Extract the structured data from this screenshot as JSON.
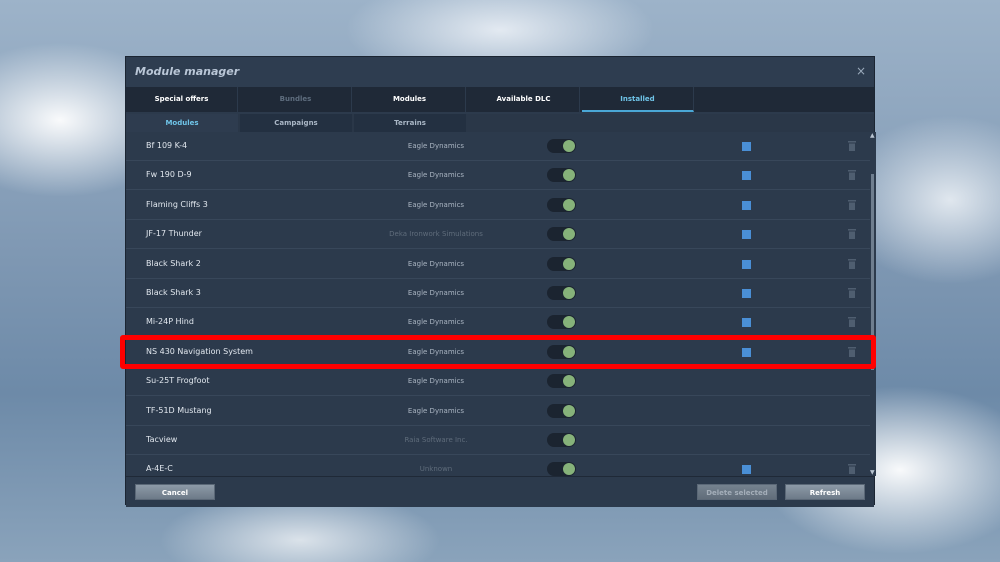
{
  "window": {
    "title": "Module manager",
    "close_glyph": "×"
  },
  "top_tabs": [
    {
      "label": "Special offers",
      "state": "normal"
    },
    {
      "label": "Bundles",
      "state": "disabled"
    },
    {
      "label": "Modules",
      "state": "normal"
    },
    {
      "label": "Available DLC",
      "state": "normal"
    },
    {
      "label": "Installed",
      "state": "active"
    }
  ],
  "sub_tabs": [
    {
      "label": "Modules",
      "state": "active"
    },
    {
      "label": "Campaigns",
      "state": "normal"
    },
    {
      "label": "Terrains",
      "state": "normal"
    }
  ],
  "modules": [
    {
      "name": "Bf 109 K-4",
      "developer": "Eagle Dynamics",
      "dev_dim": false,
      "enabled": true,
      "checkbox": true
    },
    {
      "name": "Fw 190 D-9",
      "developer": "Eagle Dynamics",
      "dev_dim": false,
      "enabled": true,
      "checkbox": true
    },
    {
      "name": "Flaming Cliffs 3",
      "developer": "Eagle Dynamics",
      "dev_dim": false,
      "enabled": true,
      "checkbox": true
    },
    {
      "name": "JF-17 Thunder",
      "developer": "Deka Ironwork Simulations",
      "dev_dim": true,
      "enabled": true,
      "checkbox": true
    },
    {
      "name": "Black Shark 2",
      "developer": "Eagle Dynamics",
      "dev_dim": false,
      "enabled": true,
      "checkbox": true
    },
    {
      "name": "Black Shark 3",
      "developer": "Eagle Dynamics",
      "dev_dim": false,
      "enabled": true,
      "checkbox": true
    },
    {
      "name": "Mi-24P Hind",
      "developer": "Eagle Dynamics",
      "dev_dim": false,
      "enabled": true,
      "checkbox": true
    },
    {
      "name": "NS 430 Navigation System",
      "developer": "Eagle Dynamics",
      "dev_dim": false,
      "enabled": true,
      "checkbox": true,
      "highlighted": true
    },
    {
      "name": "Su-25T Frogfoot",
      "developer": "Eagle Dynamics",
      "dev_dim": false,
      "enabled": true,
      "checkbox": false
    },
    {
      "name": "TF-51D Mustang",
      "developer": "Eagle Dynamics",
      "dev_dim": false,
      "enabled": true,
      "checkbox": false
    },
    {
      "name": "Tacview",
      "developer": "Raia Software Inc.",
      "dev_dim": true,
      "enabled": true,
      "checkbox": false
    },
    {
      "name": "A-4E-C",
      "developer": "Unknown",
      "dev_dim": true,
      "enabled": true,
      "checkbox": true
    }
  ],
  "footer": {
    "cancel_label": "Cancel",
    "delete_label": "Delete selected",
    "refresh_label": "Refresh"
  },
  "colors": {
    "accent": "#6fc4e8",
    "highlight_outline": "#ff0000",
    "toggle_on": "#86b27a",
    "checkbox": "#4a8fd6"
  },
  "icons": {
    "close": "close-icon",
    "toggle": "toggle-switch",
    "checkbox": "checkbox",
    "delete": "trash-icon"
  }
}
